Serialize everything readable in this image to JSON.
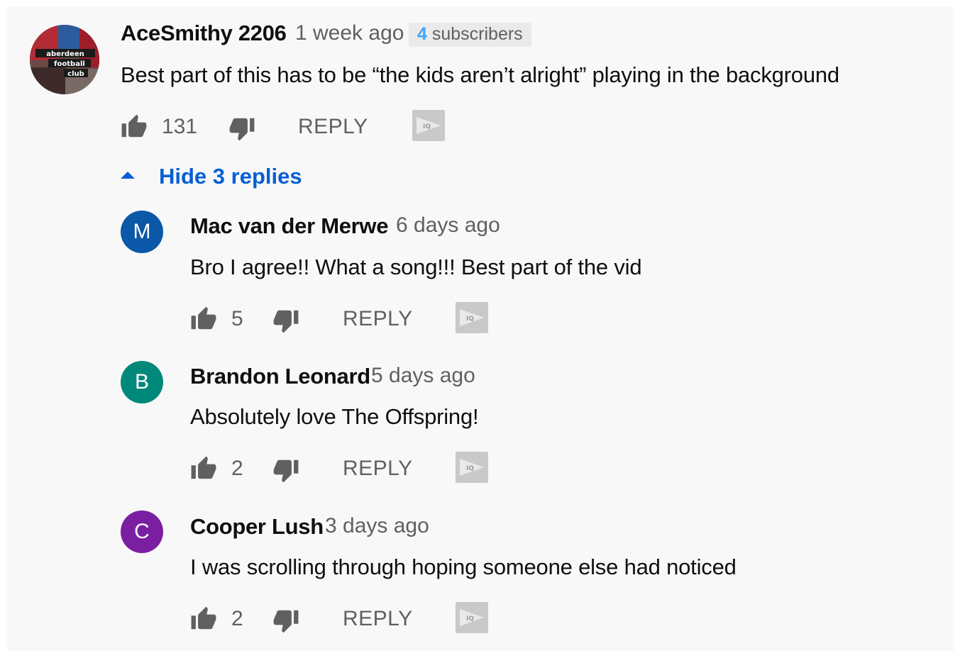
{
  "main_comment": {
    "author": "AceSmithy 2206",
    "time": "1 week ago",
    "subscribers_count": "4",
    "subscribers_label": "subscribers",
    "text": "Best part of this has to be “the kids aren’t alright” playing in the background",
    "likes": "131",
    "reply_label": "REPLY",
    "avatar_logo_text": [
      "aberdeen",
      "football",
      "club"
    ]
  },
  "replies_toggle": {
    "label": "Hide 3 replies"
  },
  "replies": [
    {
      "author": "Mac van der Merwe",
      "time": "6 days ago",
      "text": "Bro I agree!! What a song!!! Best part of the vid",
      "likes": "5",
      "reply_label": "REPLY",
      "avatar_letter": "M",
      "avatar_color": "#0b57a8"
    },
    {
      "author": "Brandon Leonard",
      "time": "5 days ago",
      "text": "Absolutely love The Offspring!",
      "likes": "2",
      "reply_label": "REPLY",
      "avatar_letter": "B",
      "avatar_color": "#00897b"
    },
    {
      "author": "Cooper Lush",
      "time": "3 days ago",
      "text": "I was scrolling through hoping someone else had noticed",
      "likes": "2",
      "reply_label": "REPLY",
      "avatar_letter": "C",
      "avatar_color": "#7b1fa2"
    }
  ],
  "icons": {
    "like": "thumbs-up-icon",
    "dislike": "thumbs-down-icon",
    "iq": "iq-icon",
    "toggle": "caret-up-icon"
  },
  "colors": {
    "link_blue": "#065fd4",
    "subscriber_blue": "#3ea6ff",
    "muted_text": "#606060"
  }
}
